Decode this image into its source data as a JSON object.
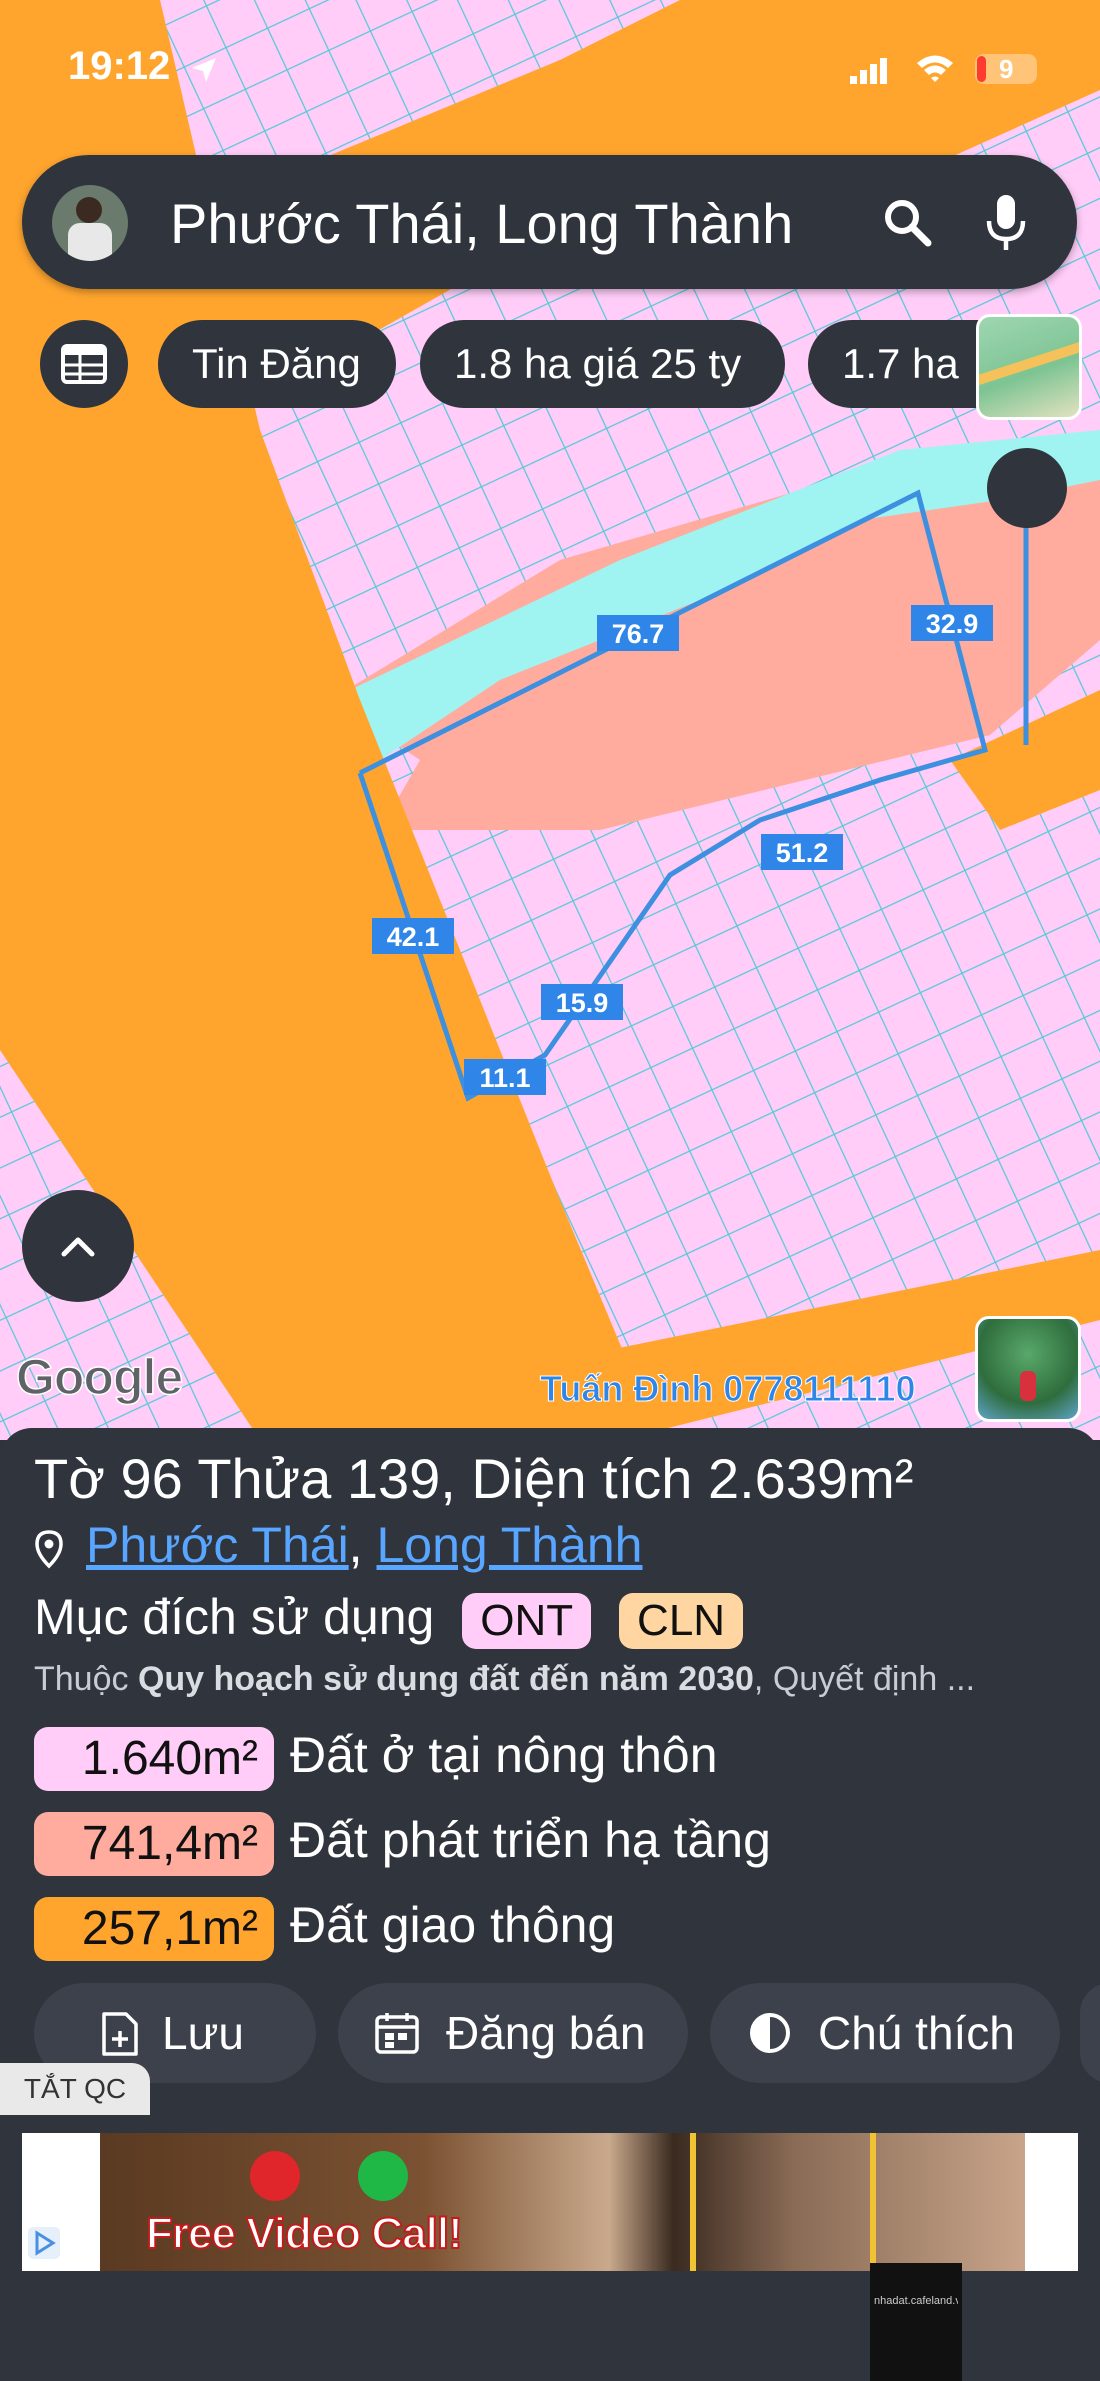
{
  "status_bar": {
    "time": "19:12",
    "battery": "9"
  },
  "search": {
    "value": "Phước Thái, Long Thành"
  },
  "chips": [
    "Tin Đăng",
    "1.8 ha giá 25 ty",
    "1.7 ha"
  ],
  "map": {
    "edge_labels": [
      "76.7",
      "32.9",
      "51.2",
      "42.1",
      "15.9",
      "11.1"
    ],
    "google_logo": "Google",
    "watermark": "Tuấn Đình 0778111110"
  },
  "parcel": {
    "title": "Tờ 96 Thửa 139, Diện tích 2.639m²",
    "location": {
      "commune": "Phước Thái",
      "separator": ",",
      "district": "Long Thành"
    },
    "purpose_label": "Mục đích sử dụng",
    "purposes": [
      {
        "code": "ONT",
        "color": "#ffcdf8"
      },
      {
        "code": "CLN",
        "color": "#ffd6a1"
      }
    ],
    "plan_prefix": "Thuộc",
    "plan_name": "Quy hoạch sử dụng đất đến năm 2030",
    "plan_suffix": ", Quyết định ...",
    "areas": [
      {
        "value": "1.640m²",
        "label": "Đất ở tại nông thôn",
        "color": "#ffcdf8"
      },
      {
        "value": "741,4m²",
        "label": "Đất phát triển hạ tầng",
        "color": "#ffab9e"
      },
      {
        "value": "257,1m²",
        "label": "Đất giao thông",
        "color": "#ffa52e"
      }
    ]
  },
  "actions": {
    "save": "Lưu",
    "post": "Đăng bán",
    "legend": "Chú thích"
  },
  "ad": {
    "label": "TẮT QC",
    "banner_text": "Free Video Call!",
    "site": "nhadat.cafeland.vn"
  },
  "colors": {
    "residential": "#ffcdf8",
    "road": "#ffa52e",
    "infrastructure": "#ffab9e",
    "water": "#9ff4f2",
    "parcel_outline": "#3d8fe0",
    "label_bg": "#2f86e8",
    "panel": "#30343c"
  }
}
